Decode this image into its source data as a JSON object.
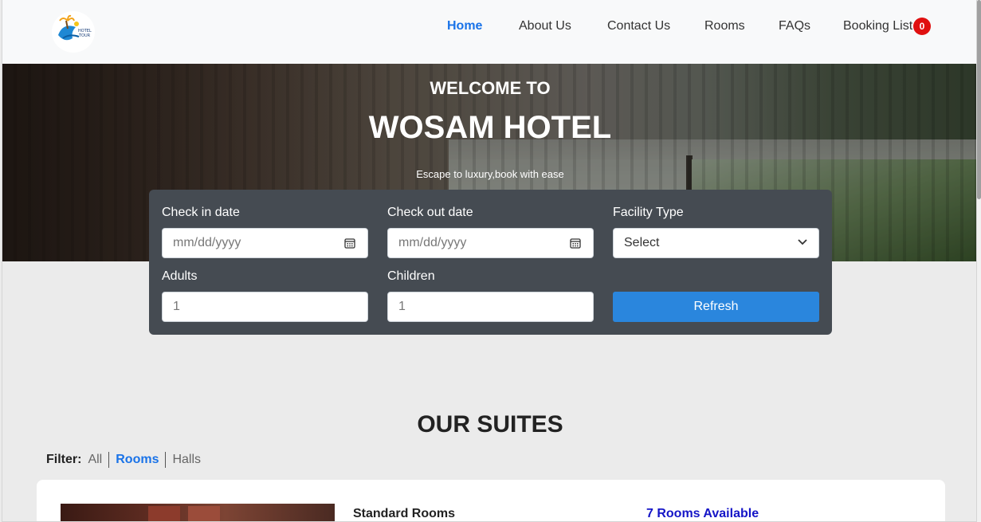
{
  "nav": {
    "logo_text": "HOTEL TOUR",
    "links": {
      "home": "Home",
      "about": "About Us",
      "contact": "Contact Us",
      "rooms": "Rooms",
      "faqs": "FAQs",
      "booking": "Booking List"
    },
    "booking_count": "0"
  },
  "hero": {
    "subtitle": "WELCOME TO",
    "title": "WOSAM HOTEL",
    "tagline": "Escape to luxury,book with ease"
  },
  "booking_form": {
    "check_in_label": "Check in date",
    "check_in_placeholder": "mm/dd/yyyy",
    "check_out_label": "Check out date",
    "check_out_placeholder": "mm/dd/yyyy",
    "facility_label": "Facility Type",
    "facility_value": "Select",
    "adults_label": "Adults",
    "adults_value": "1",
    "children_label": "Children",
    "children_value": "1",
    "refresh_label": "Refresh"
  },
  "suites": {
    "title": "OUR SUITES",
    "filter_label": "Filter:",
    "filters": [
      "All",
      "Rooms",
      "Halls"
    ],
    "active_filter": "Rooms",
    "card": {
      "title": "Standard Rooms",
      "availability": "7 Rooms Available"
    }
  },
  "colors": {
    "accent": "#1a73e8",
    "button": "#2a86dd",
    "badge": "#e01010",
    "form_bg": "#454b52",
    "availability": "#1515c7"
  }
}
